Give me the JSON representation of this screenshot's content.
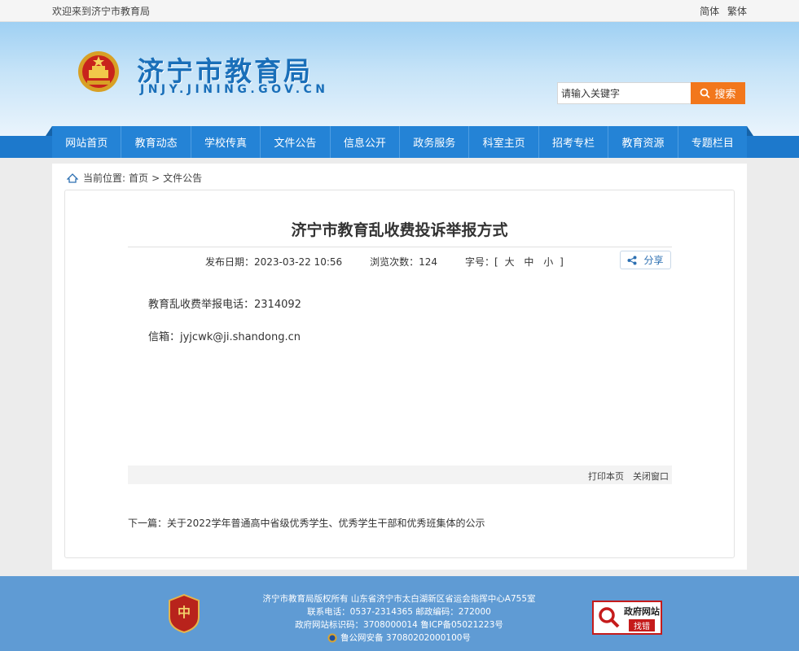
{
  "topbar": {
    "welcome": "欢迎来到济宁市教育局",
    "simplified": "简体",
    "traditional": "繁体"
  },
  "header": {
    "title": "济宁市教育局",
    "domain": "JNJY.JINING.GOV.CN",
    "search_placeholder": "请输入关键字",
    "search_label": "搜索"
  },
  "nav": {
    "items": [
      "网站首页",
      "教育动态",
      "学校传真",
      "文件公告",
      "信息公开",
      "政务服务",
      "科室主页",
      "招考专栏",
      "教育资源",
      "专题栏目"
    ]
  },
  "breadcrumb": {
    "label": "当前位置:",
    "home": "首页",
    "sep": ">",
    "current": "文件公告"
  },
  "article": {
    "title": "济宁市教育乱收费投诉举报方式",
    "date": "发布日期：2023-03-22 10:56",
    "views": "浏览次数：124",
    "size_label": "字号：[",
    "size_large": "大",
    "size_medium": "中",
    "size_small": "小",
    "size_close": "]",
    "share": "分享",
    "phone_line": "教育乱收费举报电话：2314092",
    "email_line": "信箱：jyjcwk@ji.shandong.cn",
    "print": "打印本页",
    "close": "关闭窗口",
    "next": "下一篇：关于2022学年普通高中省级优秀学生、优秀学生干部和优秀班集体的公示"
  },
  "footer": {
    "line1": "济宁市教育局版权所有   山东省济宁市太白湖新区省运会指挥中心A755室",
    "line2": "联系电话：0537-2314365   邮政编码：272000",
    "line3": "政府网站标识码：3708000014   鲁ICP备05021223号",
    "line4": "鲁公网安备 37080202000100号",
    "gov_badge_1": "政府网站",
    "gov_badge_2": "找错"
  },
  "colors": {
    "nav_blue": "#2483d6",
    "accent_orange": "#f2771c",
    "footer_blue": "#5f9bd4",
    "brand_title": "#1a6fb9"
  }
}
